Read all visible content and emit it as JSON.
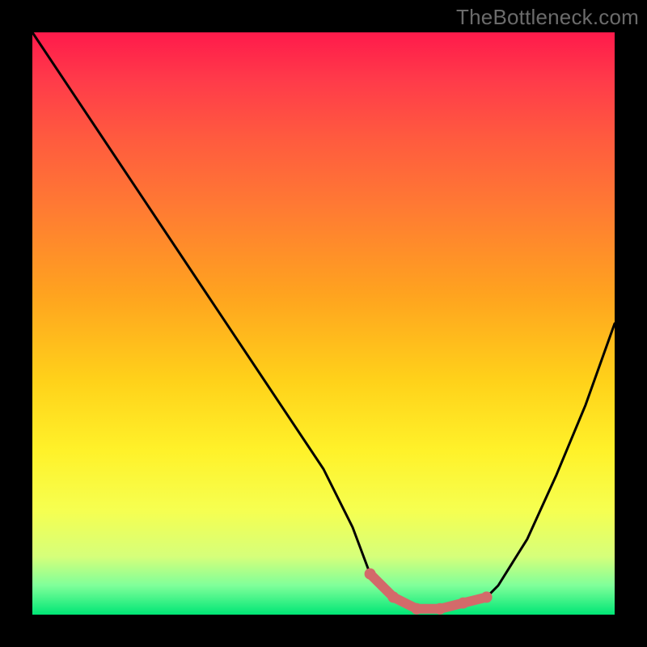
{
  "watermark": "TheBottleneck.com",
  "chart_data": {
    "type": "line",
    "title": "",
    "xlabel": "",
    "ylabel": "",
    "xlim": [
      0,
      100
    ],
    "ylim": [
      0,
      100
    ],
    "series": [
      {
        "name": "bottleneck-curve",
        "x": [
          0,
          10,
          20,
          30,
          40,
          50,
          55,
          58,
          62,
          66,
          70,
          74,
          78,
          80,
          85,
          90,
          95,
          100
        ],
        "values": [
          100,
          85,
          70,
          55,
          40,
          25,
          15,
          7,
          3,
          1,
          1,
          2,
          3,
          5,
          13,
          24,
          36,
          50
        ]
      },
      {
        "name": "optimal-highlight",
        "x": [
          58,
          62,
          66,
          70,
          74,
          78
        ],
        "values": [
          7,
          3,
          1,
          1,
          2,
          3
        ]
      }
    ],
    "colors": {
      "curve": "#000000",
      "highlight": "#d36a6a",
      "frame": "#000000"
    }
  }
}
